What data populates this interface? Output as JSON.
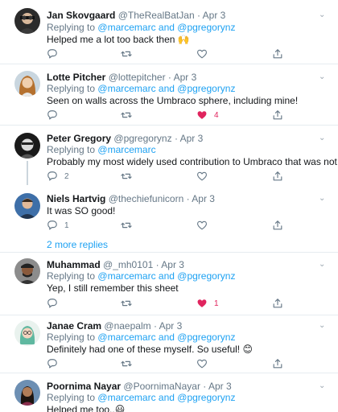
{
  "colors": {
    "accent": "#1da1f2",
    "like": "#e0245e",
    "muted": "#657786",
    "divider": "#e6ecf0"
  },
  "tweets": [
    {
      "name": "Jan Skovgaard",
      "handle": "@TheRealBatJan",
      "dot": "·",
      "date": "Apr 3",
      "replying_prefix": "Replying to",
      "replying_to": "@marcemarc and @pgregorynz",
      "text": "Helped me a lot too back then 🙌",
      "reply_count": "",
      "retweet_count": "",
      "like_count": "",
      "liked": false,
      "icons": [
        "reply-icon",
        "retweet-icon",
        "like-icon",
        "share-icon"
      ]
    },
    {
      "name": "Lotte Pitcher",
      "handle": "@lottepitcher",
      "dot": "·",
      "date": "Apr 3",
      "replying_prefix": "Replying to",
      "replying_to": "@marcemarc and @pgregorynz",
      "text": "Seen on walls across the Umbraco sphere, including mine!",
      "reply_count": "",
      "retweet_count": "",
      "like_count": "4",
      "liked": true
    },
    {
      "name": "Peter Gregory",
      "handle": "@pgregorynz",
      "dot": "·",
      "date": "Apr 3",
      "replying_prefix": "Replying to",
      "replying_to": "@marcemarc",
      "text": "Probably my most widely used contribution to Umbraco that was not code.",
      "reply_count": "2",
      "retweet_count": "",
      "like_count": "",
      "liked": false
    },
    {
      "name": "Niels Hartvig",
      "handle": "@thechiefunicorn",
      "dot": "·",
      "date": "Apr 3",
      "text": "It was SO good!",
      "reply_count": "1",
      "retweet_count": "",
      "like_count": "",
      "liked": false
    },
    {
      "name": "Muhammad",
      "handle": "@_mh0101",
      "dot": "·",
      "date": "Apr 3",
      "text": "Yep, I still remember this sheet",
      "reply_count": "",
      "retweet_count": "",
      "like_count": "1",
      "liked": true
    },
    {
      "name": "Janae Cram",
      "handle": "@naepalm",
      "dot": "·",
      "date": "Apr 3",
      "replying_prefix": "Replying to",
      "replying_to": "@marcemarc and @pgregorynz",
      "text": "Definitely had one of these myself. So useful! 😊",
      "reply_count": "",
      "retweet_count": "",
      "like_count": "",
      "liked": false
    },
    {
      "name": "Poornima Nayar",
      "handle": "@PoornimaNayar",
      "dot": "·",
      "date": "Apr 3",
      "replying_prefix": "Replying to",
      "replying_to": "@marcemarc and @pgregorynz",
      "text": "Helped me too..😃"
    }
  ],
  "more_replies": "2 more replies"
}
